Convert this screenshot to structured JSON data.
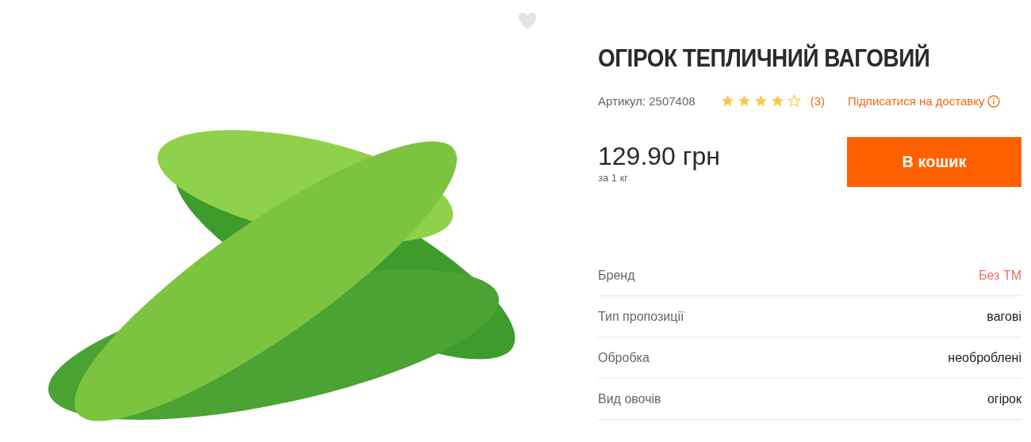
{
  "product": {
    "title": "ОГІРОК ТЕПЛИЧНИЙ ВАГОВИЙ",
    "favorite": false,
    "sku": "Артикул: 2507408",
    "stars": 4,
    "reviews": "(3)",
    "subscribe": "Підписатися на доставку",
    "price": "129.90 грн",
    "unit": "за 1 кг",
    "cart_button": "В кошик"
  },
  "specs": [
    {
      "label": "Бренд",
      "value": "Без ТМ",
      "link": true
    },
    {
      "label": "Тип пропозиції",
      "value": "вагові",
      "link": false
    },
    {
      "label": "Обробка",
      "value": "необроблені",
      "link": false
    },
    {
      "label": "Вид овочів",
      "value": "огірок",
      "link": false
    }
  ]
}
